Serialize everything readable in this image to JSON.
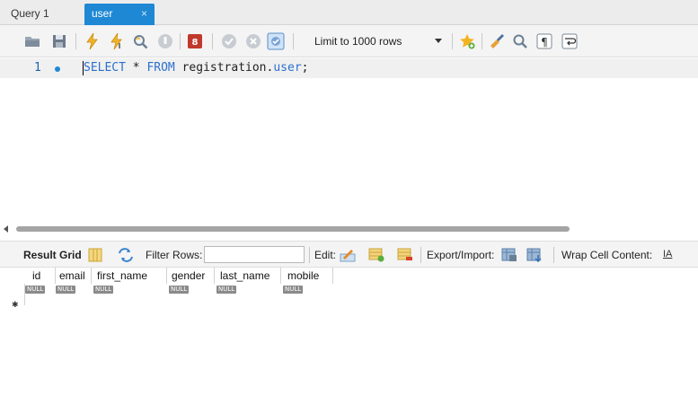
{
  "tabs": [
    {
      "label": "Query 1",
      "active": false
    },
    {
      "label": "user",
      "active": true,
      "close": "×"
    }
  ],
  "toolbar": {
    "limit_label": "Limit to 1000 rows",
    "icons": [
      "folder-icon",
      "save-icon",
      "lightning-icon",
      "lightning-cursor-icon",
      "magnifier-icon",
      "stop-icon",
      "toggle-error-icon",
      "commit-icon",
      "rollback-icon",
      "autocommit-icon",
      "beautify-star-icon",
      "brush-icon",
      "find-icon",
      "invisible-chars-icon",
      "wrap-icon"
    ]
  },
  "editor": {
    "line_number": "1",
    "keyword_select": "SELECT",
    "star": " * ",
    "keyword_from": "FROM",
    "schema": " registration.",
    "table": "user",
    "semicolon": ";"
  },
  "result_toolbar": {
    "result_grid": "Result Grid",
    "filter_rows": "Filter Rows:",
    "filter_value": "",
    "edit": "Edit:",
    "export_import": "Export/Import:",
    "wrap_cell": "Wrap Cell Content:",
    "wrap_icon_text": "IA"
  },
  "grid": {
    "columns": [
      "id",
      "email",
      "first_name",
      "gender",
      "last_name",
      "mobile"
    ],
    "row": [
      "NULL",
      "NULL",
      "NULL",
      "NULL",
      "NULL",
      "NULL"
    ],
    "new_row_marker": "✱"
  },
  "colors": {
    "active_tab": "#1e88d4",
    "keyword": "#2b6fcf",
    "null_badge": "#8a8a8a"
  }
}
